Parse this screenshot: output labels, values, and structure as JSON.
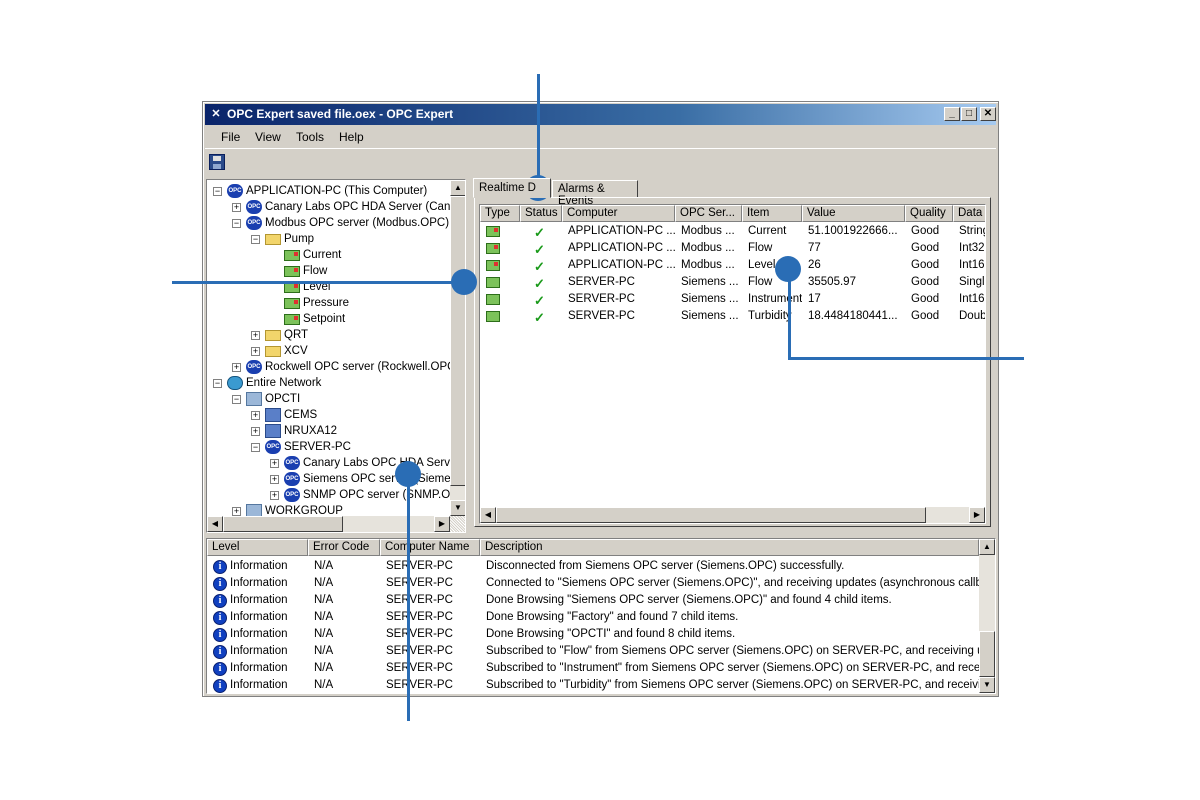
{
  "window": {
    "title": "OPC Expert saved file.oex - OPC Expert",
    "controls": {
      "minimize": "_",
      "maximize": "□",
      "close": "✕"
    }
  },
  "menu": [
    "File",
    "View",
    "Tools",
    "Help"
  ],
  "toolbar": {
    "save_icon": "floppy-disk-icon"
  },
  "tree": [
    {
      "label": "APPLICATION-PC (This Computer)",
      "icon": "computer-opc-icon",
      "expander": "−"
    },
    {
      "label": "Canary Labs OPC HDA Server (Canar",
      "icon": "opc-icon",
      "expander": "+"
    },
    {
      "label": "Modbus OPC server (Modbus.OPC)",
      "icon": "opc-connected-icon",
      "expander": "−"
    },
    {
      "label": "Pump",
      "icon": "folder-icon",
      "expander": "−"
    },
    {
      "label": "Current",
      "icon": "tag-icon",
      "expander": ""
    },
    {
      "label": "Flow",
      "icon": "tag-icon",
      "expander": ""
    },
    {
      "label": "Level",
      "icon": "tag-icon",
      "expander": ""
    },
    {
      "label": "Pressure",
      "icon": "tag-icon",
      "expander": ""
    },
    {
      "label": "Setpoint",
      "icon": "tag-icon",
      "expander": ""
    },
    {
      "label": "QRT",
      "icon": "folder-icon",
      "expander": "+"
    },
    {
      "label": "XCV",
      "icon": "folder-icon",
      "expander": "+"
    },
    {
      "label": "Rockwell OPC server (Rockwell.OPC)",
      "icon": "opc-icon",
      "expander": "+"
    },
    {
      "label": "Entire Network",
      "icon": "globe-icon",
      "expander": "−"
    },
    {
      "label": "OPCTI",
      "icon": "workgroup-icon",
      "expander": "−"
    },
    {
      "label": "CEMS",
      "icon": "computer-icon",
      "expander": "+"
    },
    {
      "label": "NRUXA12",
      "icon": "computer-icon",
      "expander": "+"
    },
    {
      "label": "SERVER-PC",
      "icon": "computer-opc-icon",
      "expander": "−"
    },
    {
      "label": "Canary Labs OPC HDA Serve",
      "icon": "opc-icon",
      "expander": "+"
    },
    {
      "label": "Siemens OPC server (Siemens",
      "icon": "opc-connected-icon",
      "expander": "+"
    },
    {
      "label": "SNMP OPC server (SNMP.OP",
      "icon": "opc-icon",
      "expander": "+"
    },
    {
      "label": "WORKGROUP",
      "icon": "workgroup-icon",
      "expander": "+"
    }
  ],
  "tabs": [
    "Realtime D",
    "Alarms & Events"
  ],
  "grid": {
    "columns": [
      "Type",
      "Status",
      "Computer",
      "OPC Ser...",
      "Item",
      "Value",
      "Quality",
      "Data"
    ],
    "rows": [
      {
        "type": "tag-red",
        "status": "✓",
        "computer": "APPLICATION-PC ...",
        "server": "Modbus ...",
        "item": "Current",
        "value": "51.1001922666...",
        "quality": "Good",
        "datatype": "String"
      },
      {
        "type": "tag-red",
        "status": "✓",
        "computer": "APPLICATION-PC ...",
        "server": "Modbus ...",
        "item": "Flow",
        "value": "77",
        "quality": "Good",
        "datatype": "Int32"
      },
      {
        "type": "tag-red",
        "status": "✓",
        "computer": "APPLICATION-PC ...",
        "server": "Modbus ...",
        "item": "Level",
        "value": "26",
        "quality": "Good",
        "datatype": "Int16"
      },
      {
        "type": "tag",
        "status": "✓",
        "computer": "SERVER-PC",
        "server": "Siemens ...",
        "item": "Flow",
        "value": "35505.97",
        "quality": "Good",
        "datatype": "Single"
      },
      {
        "type": "tag",
        "status": "✓",
        "computer": "SERVER-PC",
        "server": "Siemens ...",
        "item": "Instrument",
        "value": "17",
        "quality": "Good",
        "datatype": "Int16"
      },
      {
        "type": "tag",
        "status": "✓",
        "computer": "SERVER-PC",
        "server": "Siemens ...",
        "item": "Turbidity",
        "value": "18.4484180441...",
        "quality": "Good",
        "datatype": "Doubl"
      }
    ]
  },
  "log": {
    "columns": [
      "Level",
      "Error Code",
      "Computer Name",
      "Description"
    ],
    "rows": [
      {
        "level": "Information",
        "code": "N/A",
        "computer": "SERVER-PC",
        "description": "Disconnected from Siemens OPC server (Siemens.OPC) successfully."
      },
      {
        "level": "Information",
        "code": "N/A",
        "computer": "SERVER-PC",
        "description": "Connected to \"Siemens OPC server (Siemens.OPC)\", and receiving updates (asynchronous callbacks)!"
      },
      {
        "level": "Information",
        "code": "N/A",
        "computer": "SERVER-PC",
        "description": "Done Browsing \"Siemens OPC server (Siemens.OPC)\" and found 4 child items."
      },
      {
        "level": "Information",
        "code": "N/A",
        "computer": "SERVER-PC",
        "description": "Done Browsing \"Factory\" and found 7 child items."
      },
      {
        "level": "Information",
        "code": "N/A",
        "computer": "SERVER-PC",
        "description": "Done Browsing \"OPCTI\" and found 8 child items."
      },
      {
        "level": "Information",
        "code": "N/A",
        "computer": "SERVER-PC",
        "description": "Subscribed to \"Flow\" from Siemens OPC server (Siemens.OPC) on SERVER-PC, and receiving updat..."
      },
      {
        "level": "Information",
        "code": "N/A",
        "computer": "SERVER-PC",
        "description": "Subscribed to \"Instrument\" from Siemens OPC server (Siemens.OPC) on SERVER-PC, and receiving ..."
      },
      {
        "level": "Information",
        "code": "N/A",
        "computer": "SERVER-PC",
        "description": "Subscribed to \"Turbidity\" from Siemens OPC server (Siemens.OPC) on SERVER-PC, and receiving u..."
      }
    ]
  },
  "colors": {
    "callout": "#2a6db5",
    "titlebar_start": "#0a246a",
    "titlebar_end": "#a6caf0",
    "status_ok": "#1a9a1a"
  }
}
